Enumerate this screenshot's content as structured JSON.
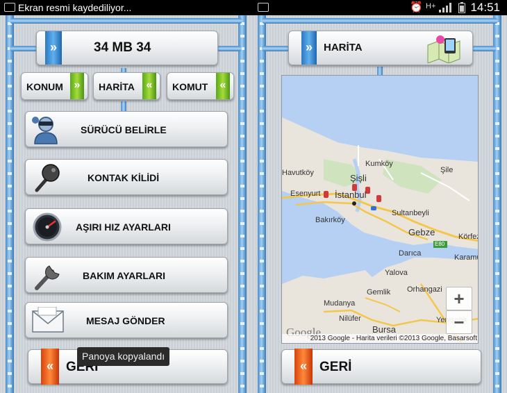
{
  "status_bar": {
    "notification_title": "Ekran resmi kaydediliyor...",
    "network_label": "H+",
    "time": "14:51"
  },
  "left_panel": {
    "plate": "34 MB 34",
    "tabs": [
      {
        "label": "KONUM"
      },
      {
        "label": "HARİTA"
      },
      {
        "label": "KOMUT"
      }
    ],
    "menu_items": [
      {
        "label": "SÜRÜCÜ BELİRLE",
        "icon": "driver-icon"
      },
      {
        "label": "KONTAK KİLİDİ",
        "icon": "key-icon"
      },
      {
        "label": "AŞIRI HIZ AYARLARI",
        "icon": "speedometer-icon"
      },
      {
        "label": "BAKIM AYARLARI",
        "icon": "wrench-icon"
      },
      {
        "label": "MESAJ GÖNDER",
        "icon": "envelope-icon"
      }
    ],
    "back_label": "GERİ",
    "toast": "Panoya kopyalandı"
  },
  "right_panel": {
    "title": "HARİTA",
    "map": {
      "labels": {
        "kumkoy": "Kumköy",
        "havutkoy": "Havutköy",
        "sisli": "Şişli",
        "sile": "Şile",
        "esenyurt": "Esenyurt",
        "istanbul": "İstanbul",
        "sultanbeyli": "Sultanbeyli",
        "bakirkoy": "Bakırköy",
        "gebze": "Gebze",
        "korfez": "Körfez",
        "e80": "E80",
        "darica": "Darıca",
        "karamursel": "Karamürsel",
        "yalova": "Yalova",
        "orhangazi": "Orhangazi",
        "gemlik": "Gemlik",
        "mudanya": "Mudanya",
        "nilufer": "Nilüfer",
        "bursa": "Bursa",
        "yenisehir": "Yenişehir"
      },
      "zoom_in": "+",
      "zoom_out": "−",
      "google_logo": "Google",
      "copyright": "2013 Google - Harita verileri ©2013 Google, Basarsoft"
    },
    "back_label": "GERİ"
  },
  "colors": {
    "blue_tab": "#2a78c3",
    "green_tab": "#6fbf1f",
    "red_tab": "#e0500f",
    "water": "#b5d0f3",
    "land": "#eae5dc"
  }
}
